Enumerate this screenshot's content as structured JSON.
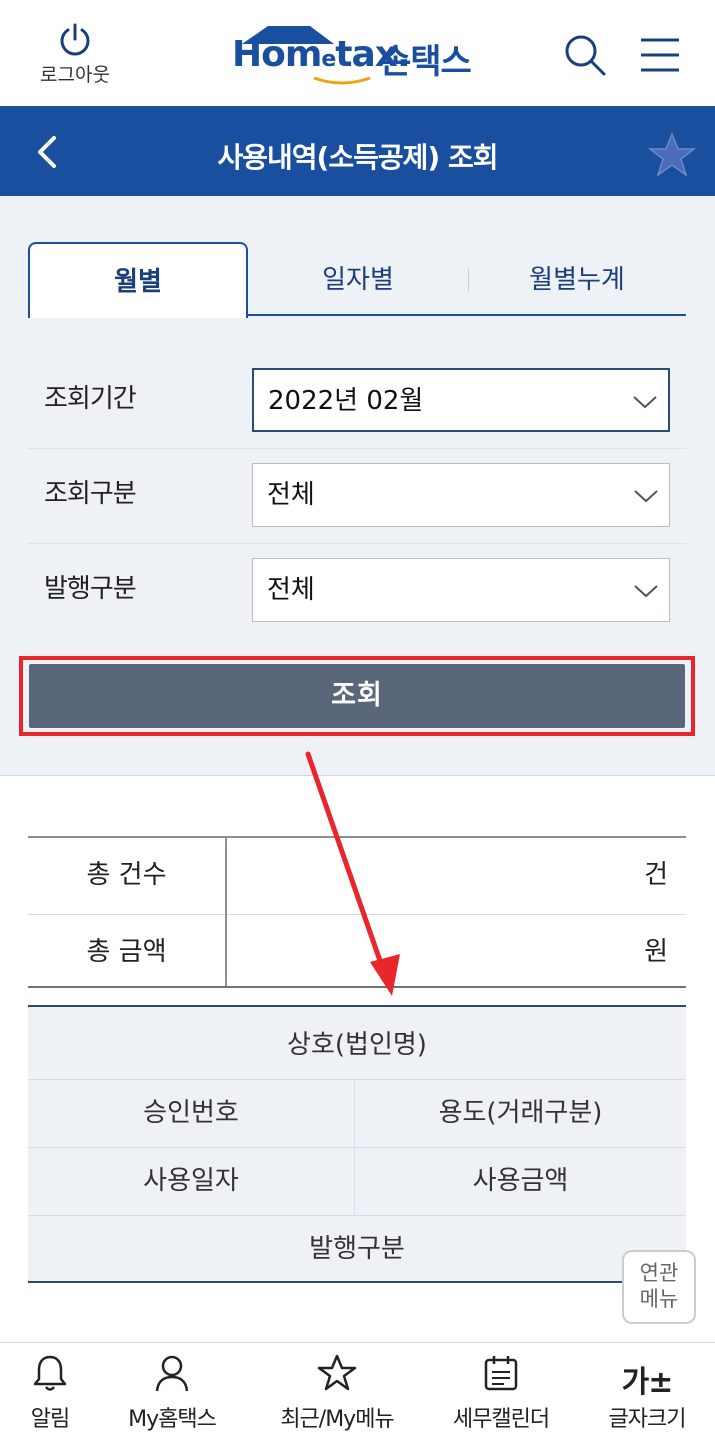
{
  "header": {
    "logout_label": "로그아웃",
    "logo_home": "Hom",
    "logo_e": "e",
    "logo_tax": "tax.",
    "logo_ko": "손택스"
  },
  "titlebar": {
    "title": "사용내역(소득공제) 조회"
  },
  "tabs": [
    {
      "label": "월별",
      "active": true
    },
    {
      "label": "일자별",
      "active": false
    },
    {
      "label": "월별누계",
      "active": false
    }
  ],
  "filters": {
    "period_label": "조회기간",
    "period_value": "2022년 02월",
    "type_label": "조회구분",
    "type_value": "전체",
    "issue_label": "발행구분",
    "issue_value": "전체"
  },
  "search_button": "조회",
  "summary": {
    "count_label": "총 건수",
    "count_unit": "건",
    "amount_label": "총 금액",
    "amount_unit": "원"
  },
  "detail_headers": {
    "company": "상호(법인명)",
    "approval_no": "승인번호",
    "purpose": "용도(거래구분)",
    "use_date": "사용일자",
    "use_amount": "사용금액",
    "issue_type": "발행구분"
  },
  "related_menu": {
    "line1": "연관",
    "line2": "메뉴"
  },
  "bottom_nav": [
    {
      "label": "알림",
      "icon": "bell-icon"
    },
    {
      "label": "My홈택스",
      "icon": "user-icon"
    },
    {
      "label": "최근/My메뉴",
      "icon": "star-icon"
    },
    {
      "label": "세무캘린더",
      "icon": "calendar-icon"
    },
    {
      "label": "글자크기",
      "icon": "font-size-icon",
      "glyph": "가±"
    }
  ],
  "colors": {
    "brand_blue": "#1a4fa0",
    "search_button": "#5a6679",
    "highlight_red": "#e8262b",
    "panel_bg": "#eef1f6"
  }
}
